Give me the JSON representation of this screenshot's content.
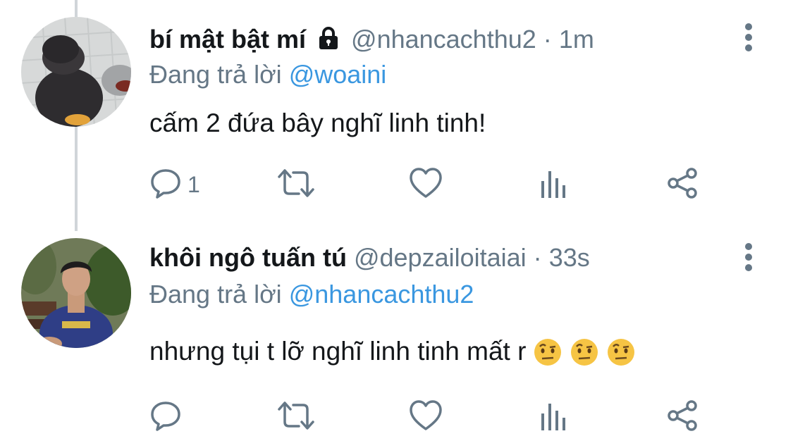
{
  "tweets": [
    {
      "display_name": "bí mật bật mí",
      "protected": true,
      "handle": "@nhancachthu2",
      "separator": "·",
      "time": "1m",
      "replying_prefix": "Đang trả lời",
      "replying_to": "@woaini",
      "text": "cấm 2 đứa bây nghĩ linh tinh!",
      "reply_count": "1",
      "avatar_icon": "penguin-plush-avatar"
    },
    {
      "display_name": "khôi ngô tuấn tú",
      "protected": false,
      "handle": "@depzailoitaiai",
      "separator": "·",
      "time": "33s",
      "replying_prefix": "Đang trả lời",
      "replying_to": "@nhancachthu2",
      "text": "nhưng tụi t lỡ nghĩ linh tinh mất r",
      "emojis": [
        "face-with-raised-eyebrow",
        "face-with-raised-eyebrow",
        "face-with-raised-eyebrow"
      ],
      "reply_count": "",
      "avatar_icon": "person-photo-avatar"
    }
  ],
  "icons": {
    "reply": "reply-icon",
    "retweet": "retweet-icon",
    "like": "like-icon",
    "analytics": "analytics-icon",
    "share": "share-icon",
    "more": "more-options-icon",
    "lock": "lock-icon"
  },
  "colors": {
    "text": "#14171a",
    "secondary": "#657786",
    "link": "#3a97e0",
    "thread_line": "#d0d5d9"
  }
}
